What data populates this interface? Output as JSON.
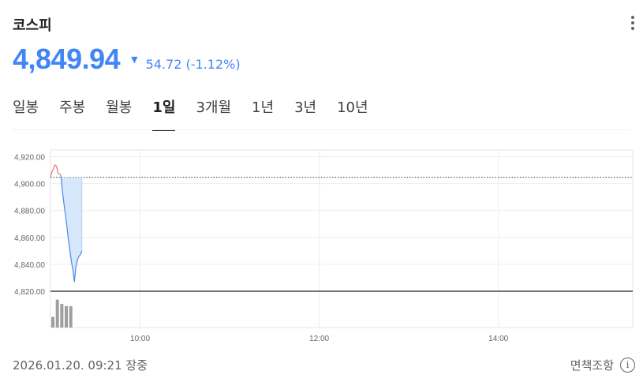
{
  "header": {
    "title": "코스피",
    "price": "4,849.94",
    "direction_arrow": "▼",
    "change": "54.72 (-1.12%)",
    "change_color": "#4285f4",
    "menu_icon": "more-vert-icon"
  },
  "tabs": [
    {
      "label": "일봉",
      "active": false
    },
    {
      "label": "주봉",
      "active": false
    },
    {
      "label": "월봉",
      "active": false
    },
    {
      "label": "1일",
      "active": true
    },
    {
      "label": "3개월",
      "active": false
    },
    {
      "label": "1년",
      "active": false
    },
    {
      "label": "3년",
      "active": false
    },
    {
      "label": "10년",
      "active": false
    }
  ],
  "chart_data": {
    "type": "line",
    "y_ticks": [
      "4,920.00",
      "4,900.00",
      "4,880.00",
      "4,860.00",
      "4,840.00",
      "4,820.00"
    ],
    "ylim": [
      4820,
      4925
    ],
    "x_ticks": [
      "10:00",
      "12:00",
      "14:00"
    ],
    "xlim": [
      "09:00",
      "15:30"
    ],
    "previous_close": 4904.66,
    "series": [
      {
        "color_up": "#e57373",
        "color_down": "#4a8bdf",
        "x": [
          "09:00",
          "09:01",
          "09:02",
          "09:03",
          "09:04",
          "09:05",
          "09:06",
          "09:07",
          "09:08",
          "09:09",
          "09:10",
          "09:11",
          "09:12",
          "09:13",
          "09:14",
          "09:15",
          "09:16",
          "09:17",
          "09:18",
          "09:19",
          "09:20",
          "09:21"
        ],
        "values": [
          4905,
          4909,
          4911,
          4914,
          4913,
          4908,
          4907,
          4906,
          4894,
          4885,
          4877,
          4868,
          4858,
          4850,
          4842,
          4836,
          4827,
          4838,
          4843,
          4846,
          4847,
          4849.94
        ]
      }
    ],
    "volume": [
      {
        "x": "09:00",
        "value": 5
      },
      {
        "x": "09:03",
        "value": 13
      },
      {
        "x": "09:06",
        "value": 11
      },
      {
        "x": "09:09",
        "value": 10
      },
      {
        "x": "09:12",
        "value": 10
      }
    ],
    "volume_max": 14,
    "volume_color": "#9e9e9e",
    "fill_color": "#d6e6fb"
  },
  "footer": {
    "timestamp": "2026.01.20. 09:21 장중",
    "disclaimer": "면책조항",
    "info_icon": "i"
  }
}
